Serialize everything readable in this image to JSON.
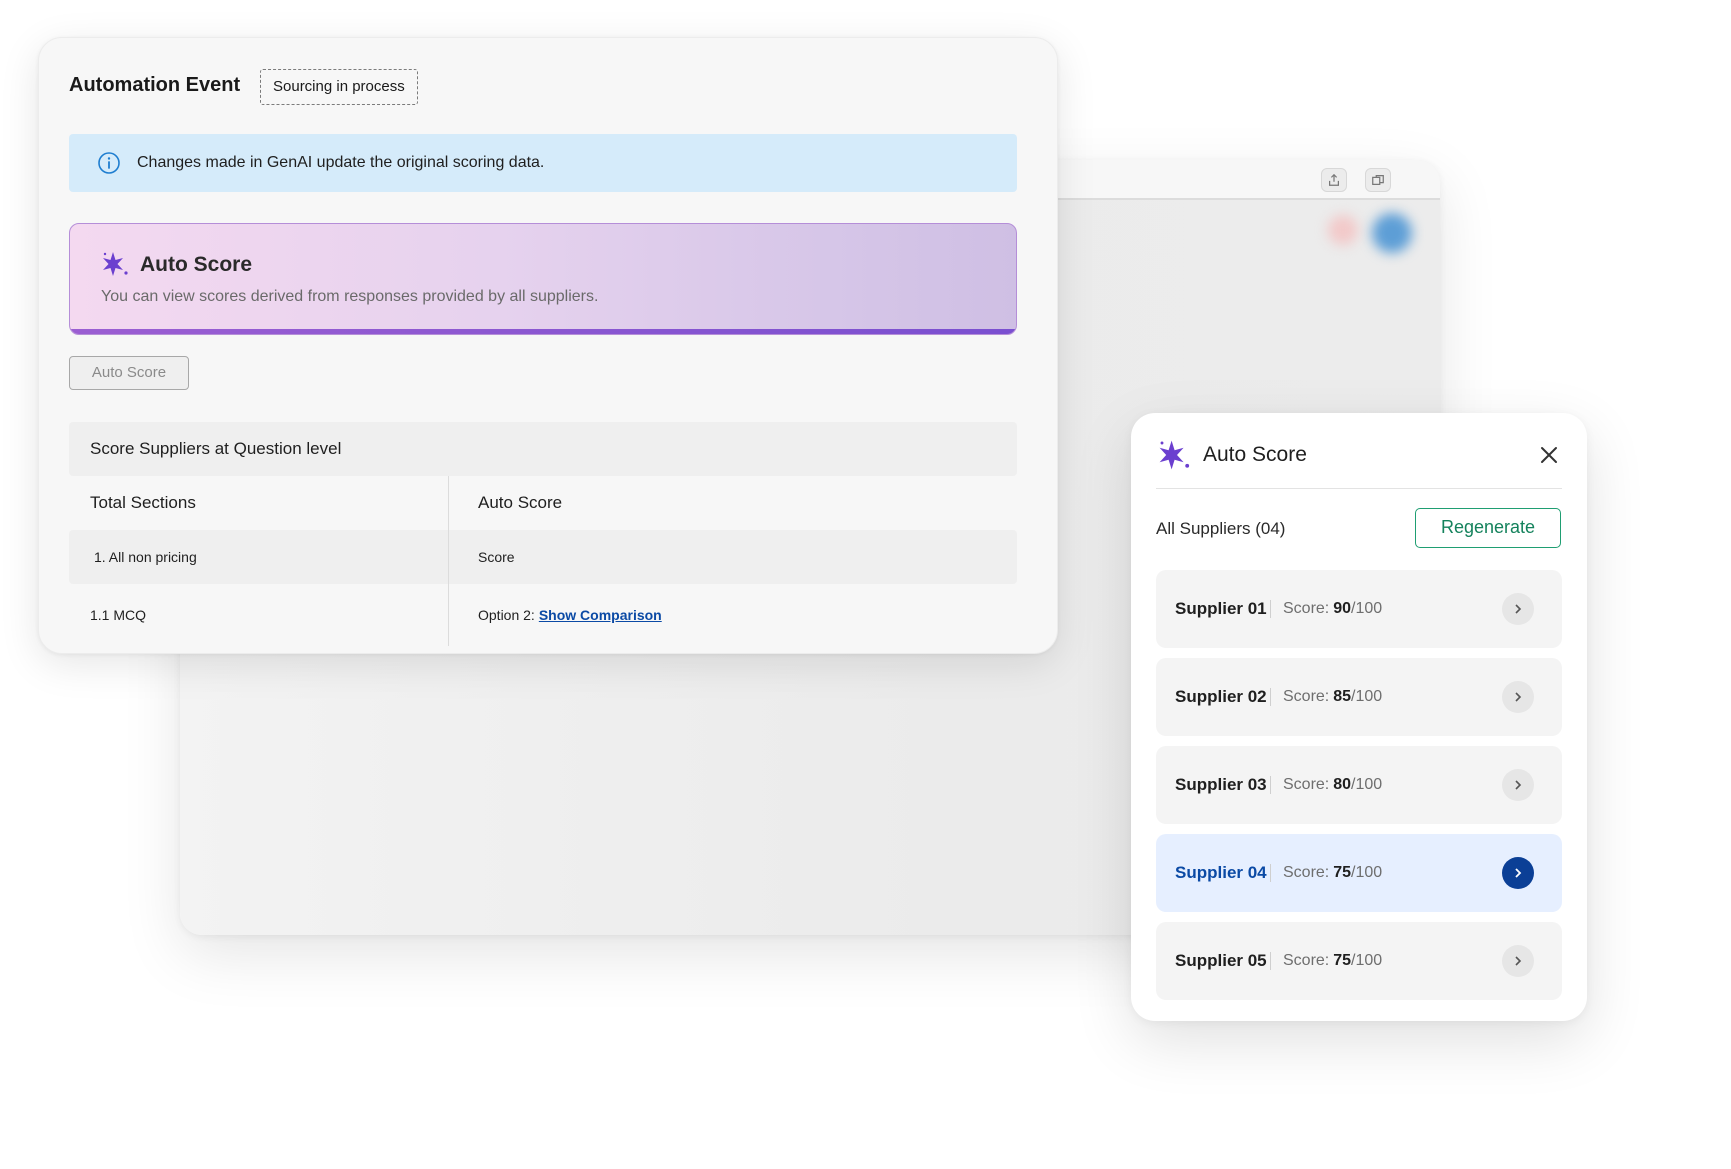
{
  "main": {
    "title": "Automation Event",
    "status_tag": "Sourcing in process",
    "info_banner": "Changes made in GenAI update the original scoring data.",
    "hero": {
      "title": "Auto Score",
      "subtitle": "You can view scores derived from responses provided by all suppliers."
    },
    "auto_score_button": "Auto Score",
    "table": {
      "heading": "Score Suppliers at Question level",
      "columns": [
        "Total Sections",
        "Auto Score"
      ],
      "rows": [
        {
          "section": "1. All non pricing",
          "value": "Score"
        },
        {
          "section": "1.1 MCQ",
          "value_prefix": "Option 2:",
          "link": "Show Comparison"
        }
      ]
    }
  },
  "panel": {
    "title": "Auto Score",
    "all_suppliers_label": "All Suppliers (04)",
    "regenerate_label": "Regenerate",
    "score_label": "Score:",
    "suppliers": [
      {
        "name": "Supplier 01",
        "score": "90",
        "max": "/100",
        "active": false
      },
      {
        "name": "Supplier 02",
        "score": "85",
        "max": "/100",
        "active": false
      },
      {
        "name": "Supplier 03",
        "score": "80",
        "max": "/100",
        "active": false
      },
      {
        "name": "Supplier 04",
        "score": "75",
        "max": "/100",
        "active": true
      },
      {
        "name": "Supplier 05",
        "score": "75",
        "max": "/100",
        "active": false
      }
    ]
  },
  "colors": {
    "accent_purple": "#7a4fd0",
    "info_blue_bg": "#d5ebfa",
    "regenerate_green": "#14825c",
    "active_blue": "#0b3f96"
  },
  "icons": [
    "info-icon",
    "sparkle-icon",
    "close-icon",
    "chevron-right-icon",
    "share-icon",
    "copy-icon"
  ]
}
